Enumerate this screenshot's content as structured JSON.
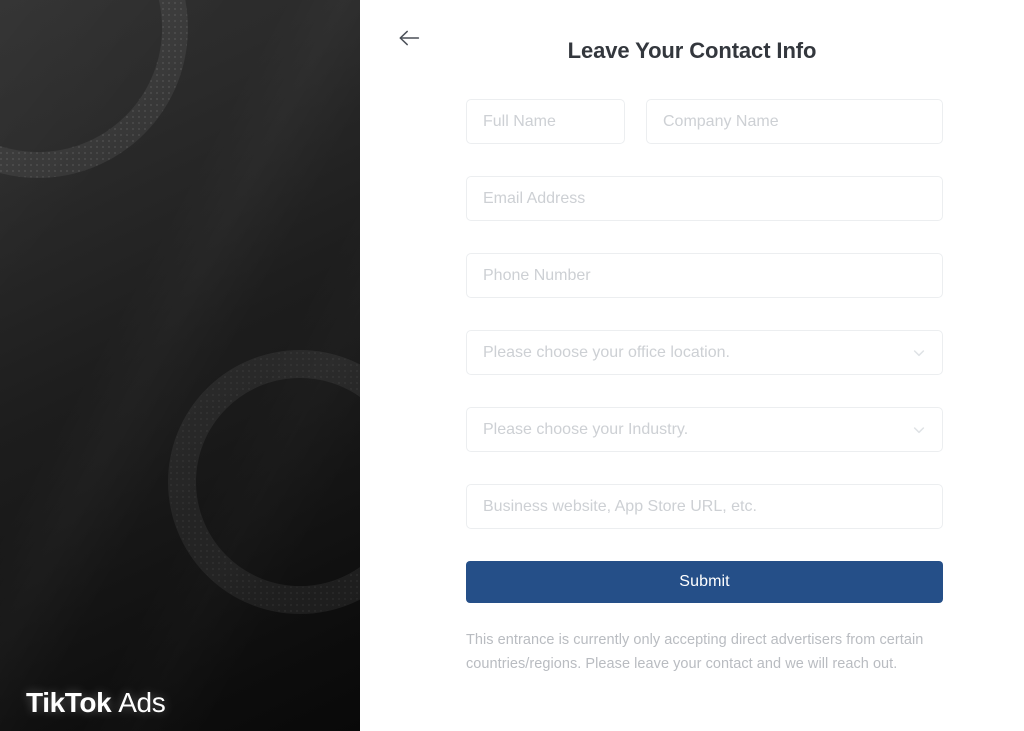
{
  "brand": {
    "logo_primary": "TikTok",
    "logo_secondary": "Ads",
    "panel_background": "#1d1d1d"
  },
  "header": {
    "back_label": "back-arrow",
    "title": "Leave Your Contact Info"
  },
  "form": {
    "fields": [
      {
        "name": "full-name",
        "placeholder": "Full Name",
        "value": "",
        "type": "text"
      },
      {
        "name": "company-name",
        "placeholder": "Company Name",
        "value": "",
        "type": "text"
      },
      {
        "name": "email-address",
        "placeholder": "Email Address",
        "value": "",
        "type": "email"
      },
      {
        "name": "phone-number",
        "placeholder": "Phone Number",
        "value": "",
        "type": "tel"
      },
      {
        "name": "office-location",
        "placeholder": "Please choose your office location.",
        "value": "",
        "type": "select"
      },
      {
        "name": "industry",
        "placeholder": "Please choose your Industry.",
        "value": "",
        "type": "select"
      },
      {
        "name": "business-website",
        "placeholder": "Business website, App Store URL, etc.",
        "value": "",
        "type": "text"
      }
    ],
    "submit_label": "Submit",
    "disclaimer": "This entrance is currently only accepting direct advertisers from certain countries/regions. Please leave your contact and we will reach out."
  },
  "colors": {
    "accent": "#254f88",
    "title_text": "#33373d",
    "placeholder_text": "#cdd0d4",
    "field_border": "#eceef0",
    "disclaimer_text": "#b9bcc1"
  }
}
